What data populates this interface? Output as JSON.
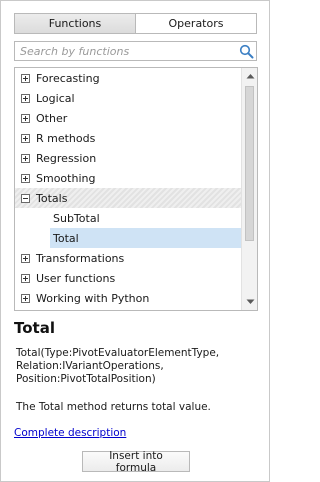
{
  "tabs": [
    {
      "label": "Functions",
      "active": true
    },
    {
      "label": "Operators",
      "active": false
    }
  ],
  "search": {
    "placeholder": "Search by functions",
    "value": "",
    "icon": "search-icon"
  },
  "tree": {
    "items": [
      {
        "label": "Forecasting",
        "expander": "plus"
      },
      {
        "label": "Logical",
        "expander": "plus"
      },
      {
        "label": "Other",
        "expander": "plus"
      },
      {
        "label": "R methods",
        "expander": "plus"
      },
      {
        "label": "Regression",
        "expander": "plus"
      },
      {
        "label": "Smoothing",
        "expander": "plus"
      },
      {
        "label": "Totals",
        "expander": "minus",
        "expanded": true
      },
      {
        "label": "SubTotal",
        "child": true
      },
      {
        "label": "Total",
        "child": true,
        "selected": true
      },
      {
        "label": "Transformations",
        "expander": "plus"
      },
      {
        "label": "User functions",
        "expander": "plus"
      },
      {
        "label": "Working with Python",
        "expander": "plus"
      }
    ]
  },
  "details": {
    "title": "Total",
    "signature": "Total(Type:PivotEvaluatorElementType, Relation:IVariantOperations, Position:PivotTotalPosition)",
    "description": "The Total method returns total value.",
    "link_label": "Complete description"
  },
  "insert_button_label": "Insert into formula",
  "colors": {
    "selection": "#cfe3f5",
    "link": "#0000cc",
    "search_icon": "#3b7fc4"
  }
}
